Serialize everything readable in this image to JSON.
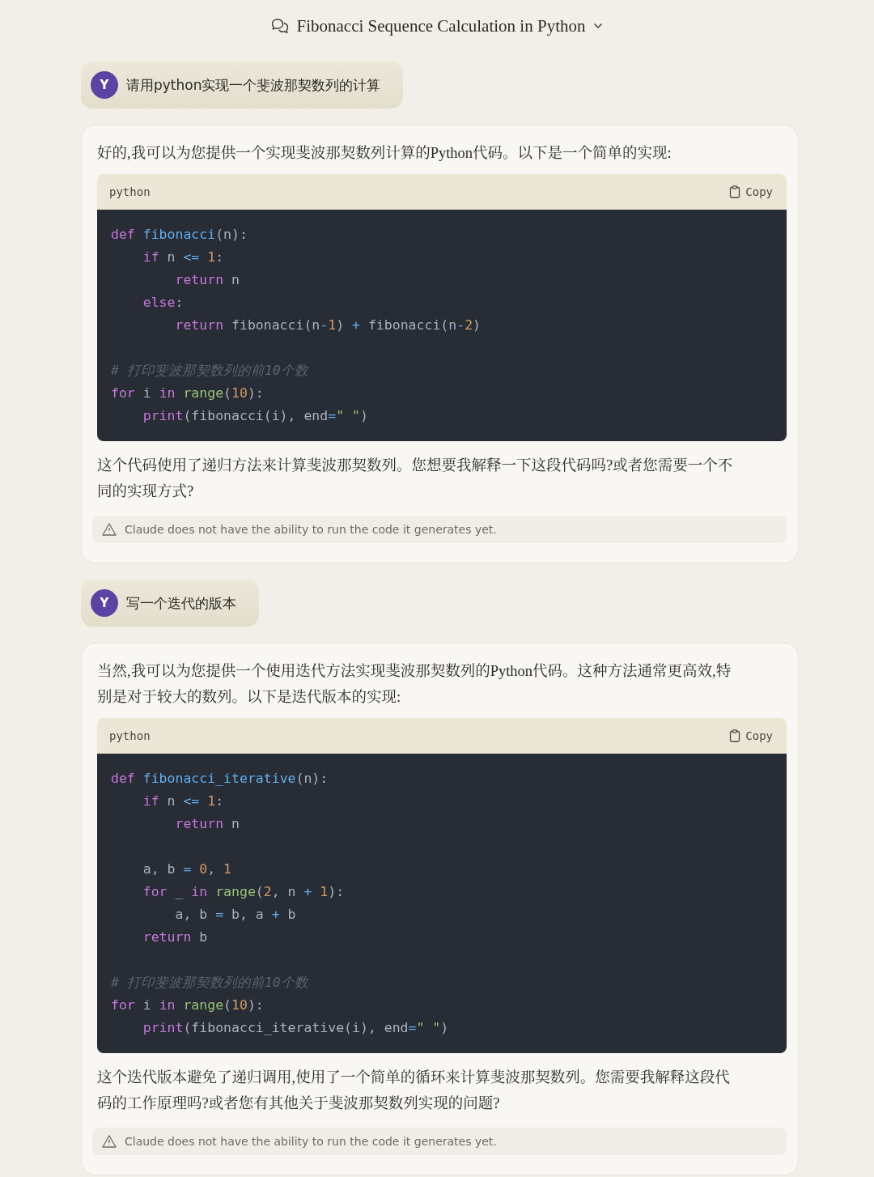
{
  "header": {
    "title": "Fibonacci Sequence Calculation in Python"
  },
  "messages": [
    {
      "kind": "user",
      "avatar": "Y",
      "text": "请用python实现一个斐波那契数列的计算"
    },
    {
      "kind": "assistant",
      "intro": "好的,我可以为您提供一个实现斐波那契数列计算的Python代码。以下是一个简单的实现:",
      "code": {
        "language": "python",
        "copy_label": "Copy",
        "lines": [
          {
            "kind": "code",
            "tokens": [
              {
                "kind": "keyword",
                "text": "def "
              },
              {
                "kind": "function",
                "text": "fibonacci"
              },
              {
                "kind": "plain",
                "text": "(n):"
              }
            ],
            "children": [
              {
                "kind": "code",
                "tokens": [
                  {
                    "kind": "keyword",
                    "text": "if "
                  },
                  {
                    "kind": "plain",
                    "text": "n "
                  },
                  {
                    "kind": "operator",
                    "text": "<= "
                  },
                  {
                    "kind": "number",
                    "text": "1"
                  },
                  {
                    "kind": "plain",
                    "text": ":"
                  }
                ],
                "children": [
                  {
                    "kind": "code",
                    "tokens": [
                      {
                        "kind": "keyword",
                        "text": "return "
                      },
                      {
                        "kind": "plain",
                        "text": "n"
                      }
                    ]
                  }
                ]
              },
              {
                "kind": "code",
                "tokens": [
                  {
                    "kind": "keyword",
                    "text": "else"
                  },
                  {
                    "kind": "plain",
                    "text": ":"
                  }
                ],
                "children": [
                  {
                    "kind": "code",
                    "tokens": [
                      {
                        "kind": "keyword",
                        "text": "return "
                      },
                      {
                        "kind": "plain",
                        "text": "fibonacci(n"
                      },
                      {
                        "kind": "operator",
                        "text": "-"
                      },
                      {
                        "kind": "number",
                        "text": "1"
                      },
                      {
                        "kind": "plain",
                        "text": ") "
                      },
                      {
                        "kind": "operator",
                        "text": "+ "
                      },
                      {
                        "kind": "plain",
                        "text": "fibonacci(n"
                      },
                      {
                        "kind": "operator",
                        "text": "-"
                      },
                      {
                        "kind": "number",
                        "text": "2"
                      },
                      {
                        "kind": "plain",
                        "text": ")"
                      }
                    ]
                  }
                ]
              }
            ]
          },
          {
            "kind": "blank"
          },
          {
            "kind": "code",
            "tokens": [
              {
                "kind": "comment",
                "text": "# 打印斐波那契数列的前10个数"
              }
            ]
          },
          {
            "kind": "code",
            "tokens": [
              {
                "kind": "keyword",
                "text": "for "
              },
              {
                "kind": "plain",
                "text": "i "
              },
              {
                "kind": "keyword",
                "text": "in "
              },
              {
                "kind": "builtin",
                "text": "range"
              },
              {
                "kind": "plain",
                "text": "("
              },
              {
                "kind": "number",
                "text": "10"
              },
              {
                "kind": "plain",
                "text": "):"
              }
            ],
            "children": [
              {
                "kind": "code",
                "tokens": [
                  {
                    "kind": "keyword",
                    "text": "print"
                  },
                  {
                    "kind": "plain",
                    "text": "(fibonacci(i), end"
                  },
                  {
                    "kind": "operator",
                    "text": "="
                  },
                  {
                    "kind": "string",
                    "text": "\" \""
                  },
                  {
                    "kind": "plain",
                    "text": ")"
                  }
                ]
              }
            ]
          }
        ]
      },
      "outro": "这个代码使用了递归方法来计算斐波那契数列。您想要我解释一下这段代码吗?或者您需要一个不同的实现方式?",
      "note": "Claude does not have the ability to run the code it generates yet."
    },
    {
      "kind": "user",
      "avatar": "Y",
      "text": "写一个迭代的版本"
    },
    {
      "kind": "assistant",
      "intro": "当然,我可以为您提供一个使用迭代方法实现斐波那契数列的Python代码。这种方法通常更高效,特别是对于较大的数列。以下是迭代版本的实现:",
      "code": {
        "language": "python",
        "copy_label": "Copy",
        "lines": [
          {
            "kind": "code",
            "tokens": [
              {
                "kind": "keyword",
                "text": "def "
              },
              {
                "kind": "function",
                "text": "fibonacci_iterative"
              },
              {
                "kind": "plain",
                "text": "(n):"
              }
            ],
            "children": [
              {
                "kind": "code",
                "tokens": [
                  {
                    "kind": "keyword",
                    "text": "if "
                  },
                  {
                    "kind": "plain",
                    "text": "n "
                  },
                  {
                    "kind": "operator",
                    "text": "<= "
                  },
                  {
                    "kind": "number",
                    "text": "1"
                  },
                  {
                    "kind": "plain",
                    "text": ":"
                  }
                ],
                "children": [
                  {
                    "kind": "code",
                    "tokens": [
                      {
                        "kind": "keyword",
                        "text": "return "
                      },
                      {
                        "kind": "plain",
                        "text": "n"
                      }
                    ]
                  }
                ]
              },
              {
                "kind": "blank"
              },
              {
                "kind": "code",
                "tokens": [
                  {
                    "kind": "plain",
                    "text": "a, b "
                  },
                  {
                    "kind": "operator",
                    "text": "= "
                  },
                  {
                    "kind": "number",
                    "text": "0"
                  },
                  {
                    "kind": "plain",
                    "text": ", "
                  },
                  {
                    "kind": "number",
                    "text": "1"
                  }
                ]
              },
              {
                "kind": "code",
                "tokens": [
                  {
                    "kind": "keyword",
                    "text": "for "
                  },
                  {
                    "kind": "plain",
                    "text": "_ "
                  },
                  {
                    "kind": "keyword",
                    "text": "in "
                  },
                  {
                    "kind": "builtin",
                    "text": "range"
                  },
                  {
                    "kind": "plain",
                    "text": "("
                  },
                  {
                    "kind": "number",
                    "text": "2"
                  },
                  {
                    "kind": "plain",
                    "text": ", n "
                  },
                  {
                    "kind": "operator",
                    "text": "+ "
                  },
                  {
                    "kind": "number",
                    "text": "1"
                  },
                  {
                    "kind": "plain",
                    "text": "):"
                  }
                ],
                "children": [
                  {
                    "kind": "code",
                    "tokens": [
                      {
                        "kind": "plain",
                        "text": "a, b "
                      },
                      {
                        "kind": "operator",
                        "text": "= "
                      },
                      {
                        "kind": "plain",
                        "text": "b, a "
                      },
                      {
                        "kind": "operator",
                        "text": "+ "
                      },
                      {
                        "kind": "plain",
                        "text": "b"
                      }
                    ]
                  }
                ]
              },
              {
                "kind": "code",
                "tokens": [
                  {
                    "kind": "keyword",
                    "text": "return "
                  },
                  {
                    "kind": "plain",
                    "text": "b"
                  }
                ]
              }
            ]
          },
          {
            "kind": "blank"
          },
          {
            "kind": "code",
            "tokens": [
              {
                "kind": "comment",
                "text": "# 打印斐波那契数列的前10个数"
              }
            ]
          },
          {
            "kind": "code",
            "tokens": [
              {
                "kind": "keyword",
                "text": "for "
              },
              {
                "kind": "plain",
                "text": "i "
              },
              {
                "kind": "keyword",
                "text": "in "
              },
              {
                "kind": "builtin",
                "text": "range"
              },
              {
                "kind": "plain",
                "text": "("
              },
              {
                "kind": "number",
                "text": "10"
              },
              {
                "kind": "plain",
                "text": "):"
              }
            ],
            "children": [
              {
                "kind": "code",
                "tokens": [
                  {
                    "kind": "keyword",
                    "text": "print"
                  },
                  {
                    "kind": "plain",
                    "text": "(fibonacci_iterative(i), end"
                  },
                  {
                    "kind": "operator",
                    "text": "="
                  },
                  {
                    "kind": "string",
                    "text": "\" \""
                  },
                  {
                    "kind": "plain",
                    "text": ")"
                  }
                ]
              }
            ]
          }
        ]
      },
      "outro": "这个迭代版本避免了递归调用,使用了一个简单的循环来计算斐波那契数列。您需要我解释这段代码的工作原理吗?或者您有其他关于斐波那契数列实现的问题?",
      "note": "Claude does not have the ability to run the code it generates yet."
    }
  ]
}
